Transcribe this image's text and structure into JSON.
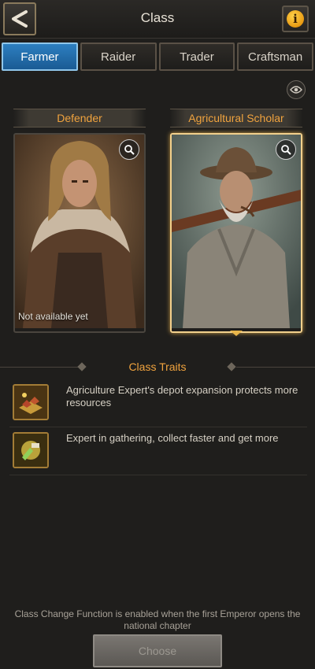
{
  "header": {
    "title": "Class",
    "back_icon": "back-arrow-icon",
    "info_icon": "info-icon",
    "info_glyph": "i"
  },
  "tabs": [
    {
      "label": "Farmer",
      "active": true
    },
    {
      "label": "Raider",
      "active": false
    },
    {
      "label": "Trader",
      "active": false
    },
    {
      "label": "Craftsman",
      "active": false
    }
  ],
  "toggle_icon": "eye-icon",
  "cards": [
    {
      "label": "Defender",
      "status": "Not available yet",
      "selected": false,
      "zoom_icon": "zoom-icon"
    },
    {
      "label": "Agricultural Scholar",
      "status": "",
      "selected": true,
      "zoom_icon": "zoom-icon"
    }
  ],
  "traits": {
    "title": "Class Traits",
    "items": [
      {
        "icon": "depot-icon",
        "text": "Agriculture Expert's depot expansion protects more resources"
      },
      {
        "icon": "gathering-icon",
        "text": "Expert in gathering, collect faster and get more"
      }
    ]
  },
  "footer": {
    "note": "Class Change Function is enabled when the first Emperor opens the national chapter",
    "choose_label": "Choose"
  },
  "colors": {
    "accent": "#f0a33e",
    "active_tab": "#2d7fc0",
    "background": "#1f1e1c"
  }
}
